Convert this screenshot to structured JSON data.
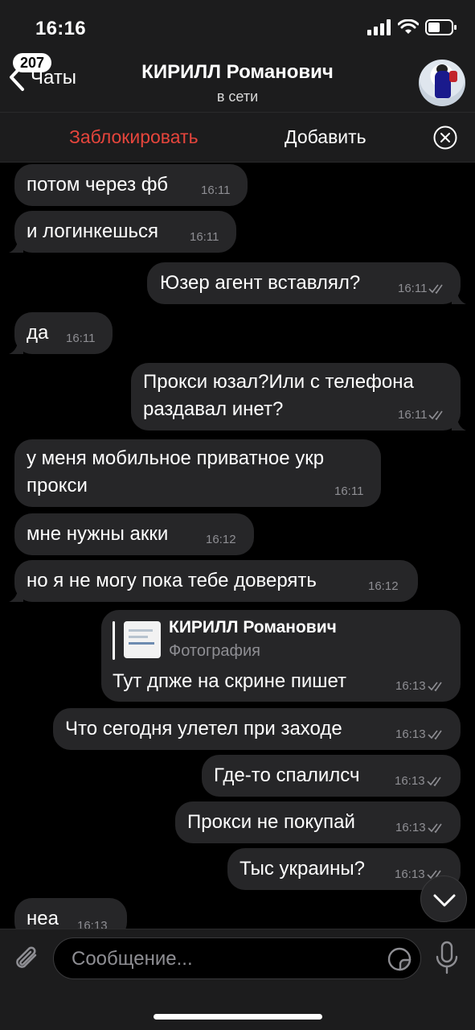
{
  "status_bar": {
    "time": "16:16"
  },
  "header": {
    "back_badge": "207",
    "back_label": "Чаты",
    "title": "КИРИЛЛ Романович",
    "subtitle": "в сети"
  },
  "action_bar": {
    "block_label": "Заблокировать",
    "add_label": "Добавить"
  },
  "messages": [
    {
      "dir": "in",
      "text": "потом через фб",
      "time": "16:11"
    },
    {
      "dir": "in",
      "text": "и логинкешься",
      "time": "16:11"
    },
    {
      "dir": "out",
      "text": "Юзер агент вставлял?",
      "time": "16:11"
    },
    {
      "dir": "in",
      "text": "да",
      "time": "16:11"
    },
    {
      "dir": "out",
      "text": "Прокси юзал?Или с телефона\nраздавал инет?",
      "time": "16:11"
    },
    {
      "dir": "in",
      "text": "у меня мобильное приватное укр\nпрокси",
      "time": "16:11"
    },
    {
      "dir": "in",
      "text": "мне нужны акки",
      "time": "16:12"
    },
    {
      "dir": "in",
      "text": "но я не могу пока тебе доверять",
      "time": "16:12"
    },
    {
      "dir": "out",
      "reply_name": "КИРИЛЛ Романович",
      "reply_sub": "Фотография",
      "text": "Тут дпже на скрине пишет",
      "time": "16:13"
    },
    {
      "dir": "out",
      "text": "Что сегодня улетел при заходе",
      "time": "16:13"
    },
    {
      "dir": "out",
      "text": "Где-то спалилсч",
      "time": "16:13"
    },
    {
      "dir": "out",
      "text": "Прокси не покупай",
      "time": "16:13"
    },
    {
      "dir": "out",
      "text": "Тыс украины?",
      "time": "16:13"
    },
    {
      "dir": "in",
      "text": "неа",
      "time": "16:13"
    }
  ],
  "input": {
    "placeholder": "Сообщение..."
  },
  "colors": {
    "accent_red": "#e5453c",
    "bubble": "#262628",
    "bar": "#1c1c1d"
  }
}
